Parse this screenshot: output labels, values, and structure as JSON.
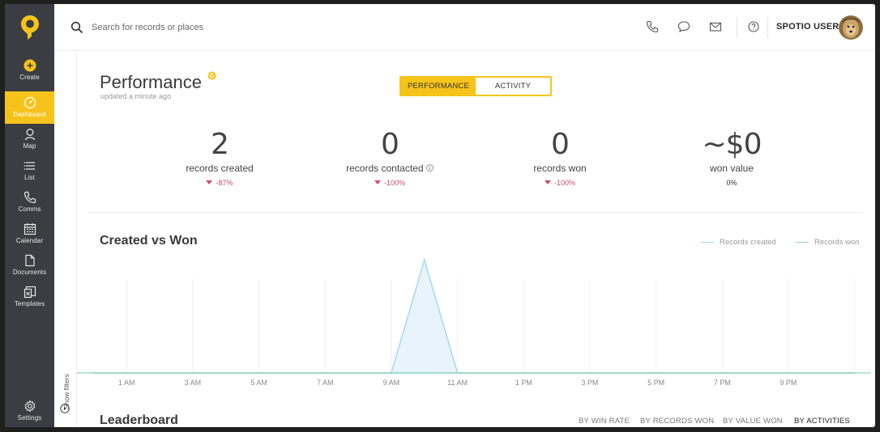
{
  "nav": {
    "items": [
      {
        "label": "Create",
        "icon": "plus-circle-icon"
      },
      {
        "label": "Dashboard",
        "icon": "dashboard-icon",
        "active": true
      },
      {
        "label": "Map",
        "icon": "map-pin-icon"
      },
      {
        "label": "List",
        "icon": "list-icon"
      },
      {
        "label": "Comms",
        "icon": "phone-icon"
      },
      {
        "label": "Calendar",
        "icon": "calendar-icon"
      },
      {
        "label": "Documents",
        "icon": "document-icon"
      },
      {
        "label": "Templates",
        "icon": "templates-icon"
      }
    ],
    "settings": {
      "label": "Settings",
      "icon": "gear-icon"
    }
  },
  "header": {
    "search_placeholder": "Search for records or places",
    "user_name": "SPOTIO USER"
  },
  "performance": {
    "title": "Performance",
    "updated": "updated a minute ago",
    "toggle": {
      "performance": "PERFORMANCE",
      "activity": "ACTIVITY"
    },
    "stats": [
      {
        "value": "2",
        "label": "records created",
        "change": "-87%"
      },
      {
        "value": "0",
        "label": "records contacted",
        "change": "-100%"
      },
      {
        "value": "0",
        "label": "records won",
        "change": "-100%"
      },
      {
        "value": "~$0",
        "label": "won value",
        "change": "0%"
      }
    ]
  },
  "chart_section": {
    "title": "Created vs Won",
    "show_filters": "Show filters"
  },
  "chart_data": {
    "type": "area",
    "title": "Created vs Won",
    "x": [
      "12 AM",
      "1 AM",
      "2 AM",
      "3 AM",
      "4 AM",
      "5 AM",
      "6 AM",
      "7 AM",
      "8 AM",
      "9 AM",
      "10 AM",
      "11 AM",
      "12 PM",
      "1 PM",
      "2 PM",
      "3 PM",
      "4 PM",
      "5 PM",
      "6 PM",
      "7 PM",
      "8 PM",
      "9 PM",
      "10 PM",
      "11 PM"
    ],
    "tick_labels": [
      "1 AM",
      "3 AM",
      "5 AM",
      "7 AM",
      "9 AM",
      "11 AM",
      "1 PM",
      "3 PM",
      "5 PM",
      "7 PM",
      "9 PM"
    ],
    "series": [
      {
        "name": "Records created",
        "color": "#a8d8f0",
        "values": [
          0,
          0,
          0,
          0,
          0,
          0,
          0,
          0,
          0,
          0,
          2,
          0,
          0,
          0,
          0,
          0,
          0,
          0,
          0,
          0,
          0,
          0,
          0,
          0
        ]
      },
      {
        "name": "Records won",
        "color": "#8fd3c1",
        "values": [
          0,
          0,
          0,
          0,
          0,
          0,
          0,
          0,
          0,
          0,
          0,
          0,
          0,
          0,
          0,
          0,
          0,
          0,
          0,
          0,
          0,
          0,
          0,
          0
        ]
      }
    ],
    "ylim": [
      0,
      2
    ],
    "legend_position": "top-right",
    "grid": true
  },
  "leaderboard": {
    "title": "Leaderboard",
    "tabs": [
      "BY WIN RATE",
      "BY RECORDS WON",
      "BY VALUE WON",
      "BY ACTIVITIES"
    ],
    "active_tab": "BY ACTIVITIES"
  },
  "colors": {
    "accent": "#f6c31b",
    "nav_bg": "#3b3d42",
    "negative": "#d04a6e"
  }
}
